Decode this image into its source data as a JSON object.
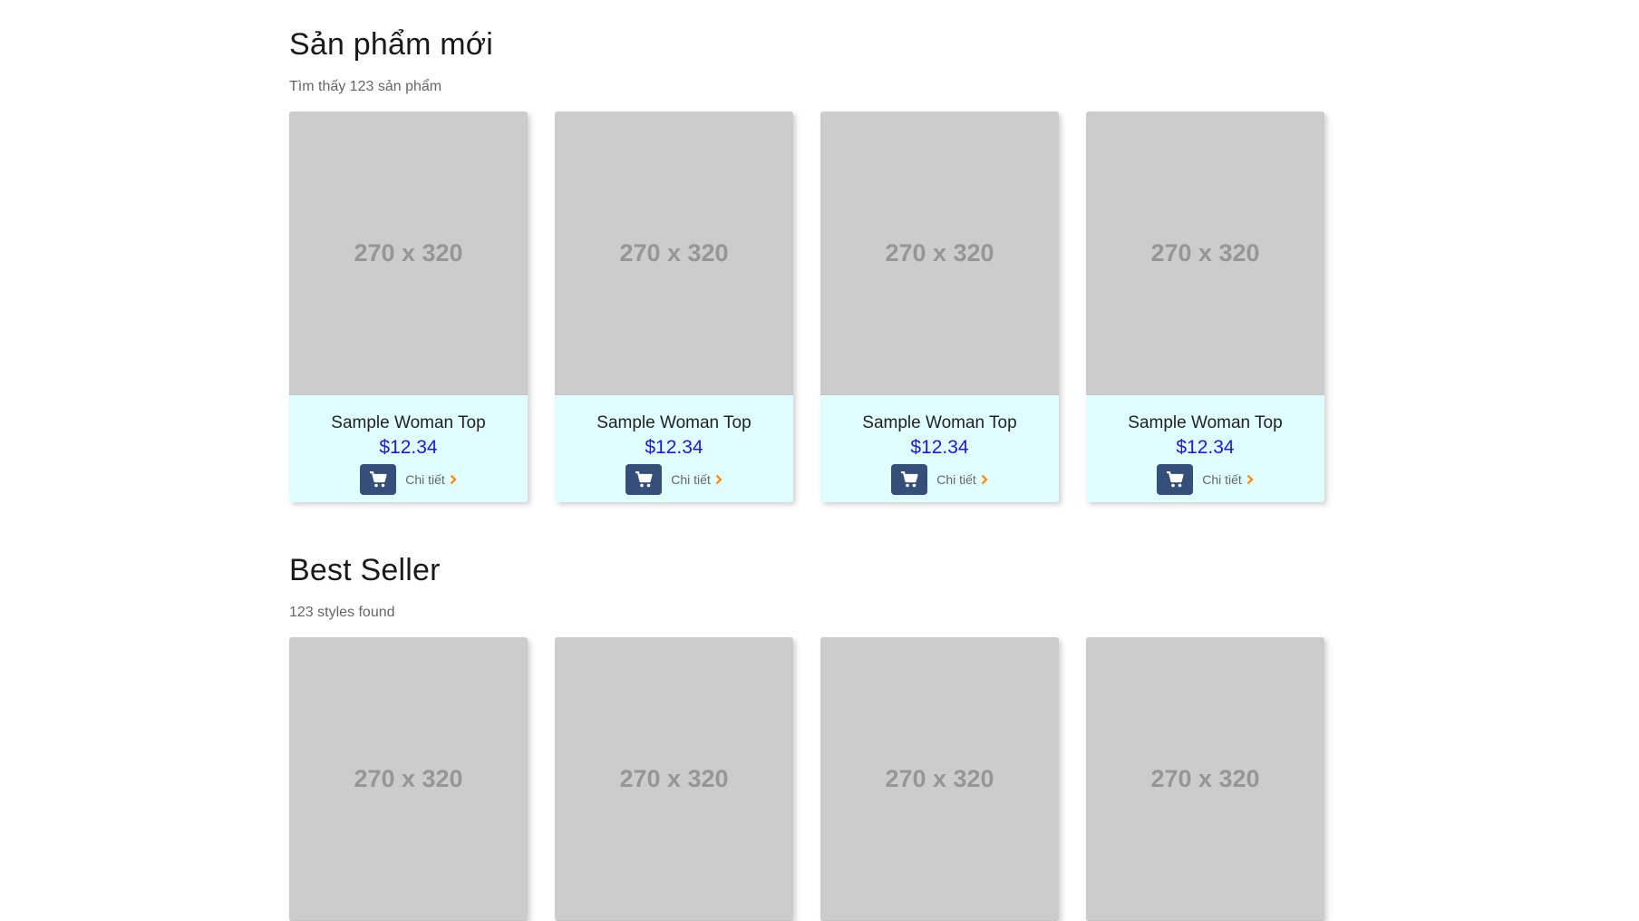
{
  "sections": [
    {
      "title": "Sản phẩm mới",
      "subtitle": "Tìm thấy 123 sản phẩm",
      "products": [
        {
          "image_text": "270 x 320",
          "name": "Sample Woman Top",
          "price": "$12.34",
          "detail_label": "Chi tiết"
        },
        {
          "image_text": "270 x 320",
          "name": "Sample Woman Top",
          "price": "$12.34",
          "detail_label": "Chi tiết"
        },
        {
          "image_text": "270 x 320",
          "name": "Sample Woman Top",
          "price": "$12.34",
          "detail_label": "Chi tiết"
        },
        {
          "image_text": "270 x 320",
          "name": "Sample Woman Top",
          "price": "$12.34",
          "detail_label": "Chi tiết"
        }
      ]
    },
    {
      "title": "Best Seller",
      "subtitle": "123 styles found",
      "products": [
        {
          "image_text": "270 x 320"
        },
        {
          "image_text": "270 x 320"
        },
        {
          "image_text": "270 x 320"
        },
        {
          "image_text": "270 x 320"
        }
      ]
    }
  ],
  "colors": {
    "card_background": "#e0feff",
    "placeholder_background": "#cccccc",
    "placeholder_text": "#969696",
    "price": "#1a1adf",
    "cart_button": "#34507a",
    "chevron": "#ff8800"
  },
  "icons": {
    "cart": "shopping-cart-icon",
    "detail": "chevron-right-icon"
  }
}
